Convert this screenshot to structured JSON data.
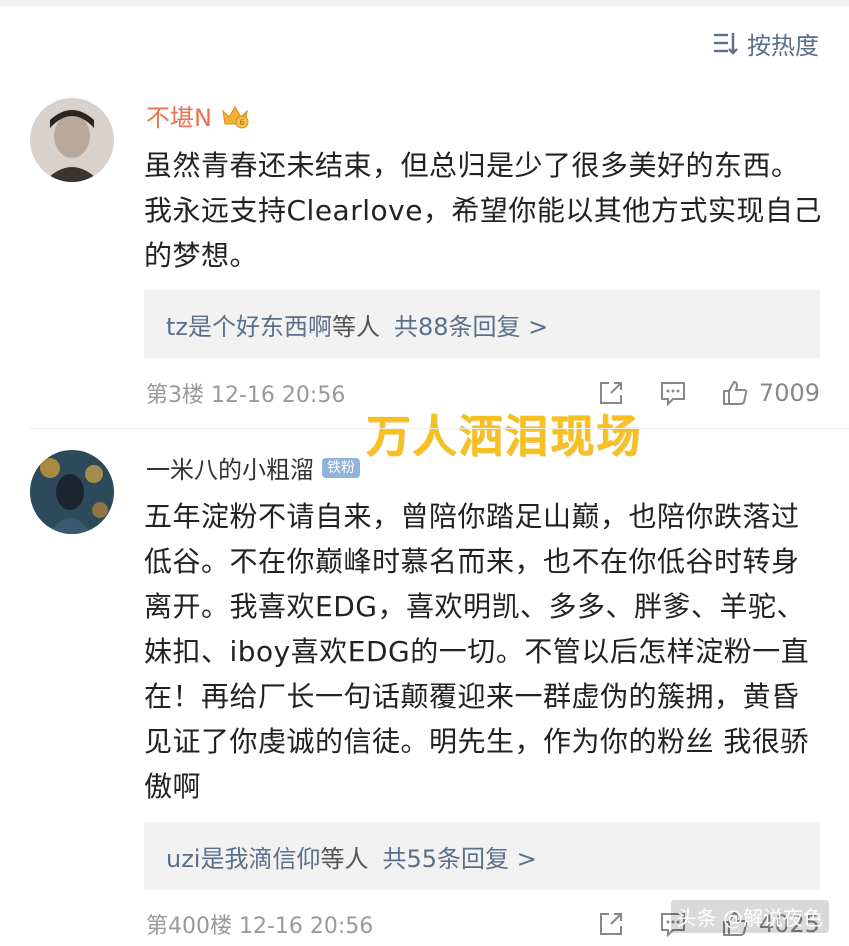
{
  "sort": {
    "label": "按热度"
  },
  "comments": [
    {
      "username": "不堪N",
      "text": "虽然青春还未结束，但总归是少了很多美好的东西。我永远支持Clearlove，希望你能以其他方式实现自己的梦想。",
      "reply_users": "tz是个好东西啊",
      "reply_mid": "等人",
      "reply_count": "共88条回复 >",
      "floor": "第3楼  12-16 20:56",
      "likes": "7009"
    },
    {
      "username": "一米八的小粗溜",
      "badge": "铁粉",
      "text": "五年淀粉不请自来，曾陪你踏足山巅，也陪你跌落过低谷。不在你巅峰时慕名而来，也不在你低谷时转身离开。我喜欢EDG，喜欢明凯、多多、胖爹、羊驼、妹扣、iboy喜欢EDG的一切。不管以后怎样淀粉一直在！再给厂长一句话颠覆迎来一群虚伪的簇拥，黄昏见证了你虔诚的信徒。明先生，作为你的粉丝 我很骄傲啊",
      "reply_users": "uzi是我滴信仰",
      "reply_mid": "等人",
      "reply_count": "共55条回复 >",
      "floor": "第400楼  12-16 20:56",
      "likes": "4025"
    }
  ],
  "overlay_caption": "万人洒泪现场",
  "watermark": "头条 @解说夜色",
  "colors": {
    "accent_name": "#eb7350",
    "link": "#5a6f8a",
    "overlay": "#f5c020"
  }
}
